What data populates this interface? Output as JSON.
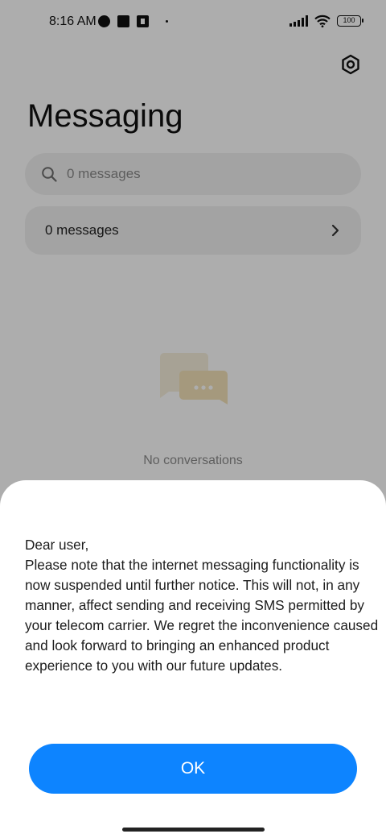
{
  "status_bar": {
    "time": "8:16 AM",
    "battery": "100"
  },
  "header": {
    "title": "Messaging",
    "settings_icon": "settings-icon"
  },
  "search": {
    "placeholder": "0 messages"
  },
  "messages_row": {
    "label": "0 messages"
  },
  "empty_state": {
    "text": "No conversations"
  },
  "dialog": {
    "message": "Dear user,\nPlease note that the internet messaging functionality is now suspended until further notice. This will not, in any manner, affect sending and receiving SMS permitted by your telecom carrier. We regret the inconvenience caused and look forward to bringing an enhanced product experience to you with our future updates.",
    "ok_label": "OK"
  },
  "colors": {
    "accent": "#0d84ff",
    "scrim": "rgba(0,0,0,0.32)",
    "illustration": "#f3e6c4"
  }
}
